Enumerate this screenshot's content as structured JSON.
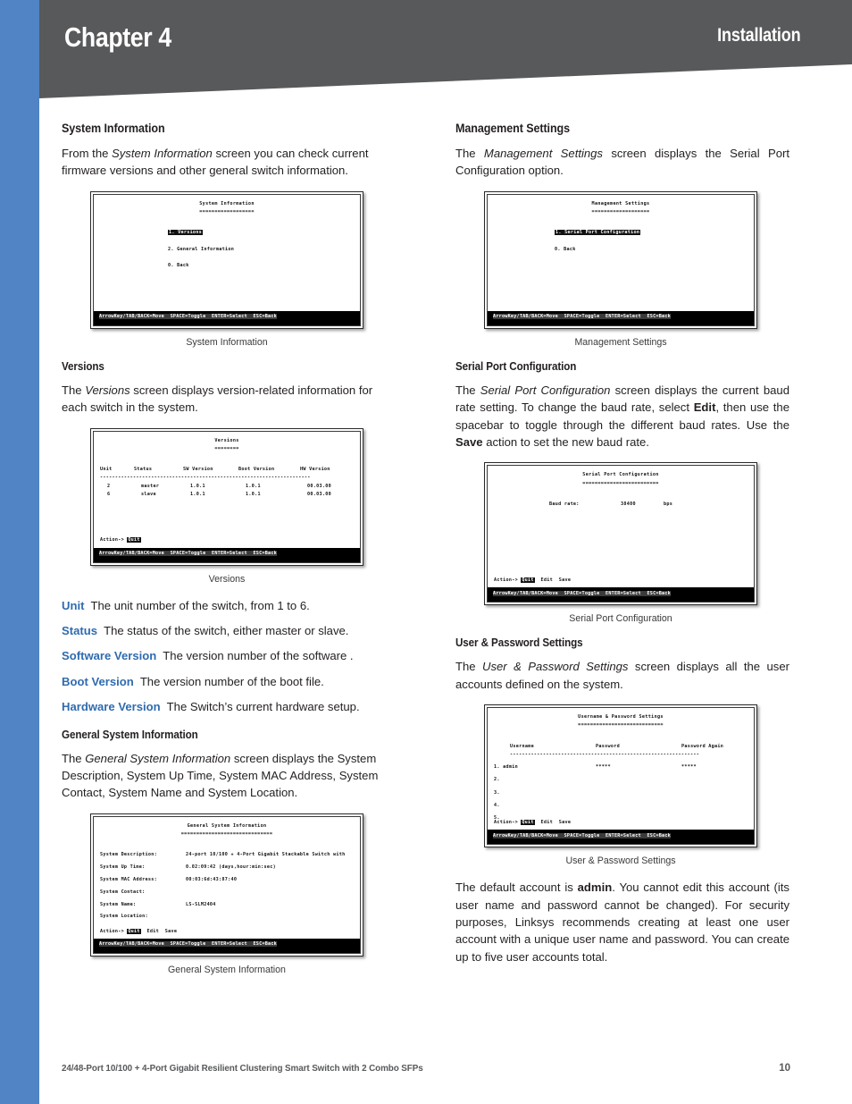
{
  "header": {
    "chapter": "Chapter 4",
    "section": "Installation",
    "band_color": "#58595b",
    "stripe_color": "#5084c4"
  },
  "footer": {
    "product": "24/48-Port 10/100 + 4-Port Gigabit Resilient Clustering Smart Switch with 2 Combo SFPs",
    "page": "10"
  },
  "left_column": {
    "system_information": {
      "heading": "System Information",
      "para_pre": "From the ",
      "para_em": "System Information",
      "para_post": " screen you can check current firmware versions and other general switch information.",
      "caption": "System Information",
      "terminal": {
        "title": "System Information",
        "rule": "==================",
        "items": [
          "1. Versions",
          "2. General Information",
          "0. Back"
        ],
        "highlighted_index": 0,
        "statusbar": "ArrowKey/TAB/BACK=Move  SPACE=Toggle  ENTER=Select  ESC=Back"
      }
    },
    "versions": {
      "heading": "Versions",
      "para_pre": "The ",
      "para_em": "Versions",
      "para_post": " screen displays version-related information for each switch in the system.",
      "caption": "Versions",
      "terminal": {
        "title": "Versions",
        "rule": "========",
        "columns": [
          "Unit",
          "Status",
          "SW Version",
          "Boot Version",
          "HW Version"
        ],
        "separator": "----------------------------------------------------------------------",
        "rows": [
          [
            "2",
            "master",
            "1.0.1",
            "1.0.1",
            "00.03.00"
          ],
          [
            "6",
            "slave",
            "1.0.1",
            "1.0.1",
            "00.03.00"
          ]
        ],
        "action_label": "Action->",
        "action_selected": "Quit",
        "statusbar": "ArrowKey/TAB/BACK=Move  SPACE=Toggle  ENTER=Select  ESC=Back"
      },
      "definitions": [
        {
          "term": "Unit",
          "desc": "The unit number of the switch, from 1 to 6."
        },
        {
          "term": "Status",
          "desc": "The status of the switch, either master or slave."
        },
        {
          "term": "Software Version",
          "desc": "The version number of the software ."
        },
        {
          "term": "Boot Version",
          "desc": "The version number of the boot file."
        },
        {
          "term": "Hardware Version",
          "desc": "The Switch’s current hardware setup."
        }
      ]
    },
    "general_system_information": {
      "heading": "General System Information",
      "para_pre": "The ",
      "para_em": "General System Information",
      "para_post": " screen displays the System Description, System Up Time, System MAC Address, System Contact, System Name and System Location.",
      "caption": "General System Information",
      "terminal": {
        "title": "General System Information",
        "rule": "==============================",
        "fields": [
          {
            "label": "System Description:",
            "value": "24-port 10/100 + 4-Port Gigabit Stackable Switch with"
          },
          {
            "label": "System Up Time:",
            "value": "0.02:09:42 (days,hour:min:sec)"
          },
          {
            "label": "System MAC Address:",
            "value": "00:03:6d:43:87:40"
          },
          {
            "label": "System Contact:",
            "value": ""
          },
          {
            "label": "System Name:",
            "value": "LS-SLM2404"
          },
          {
            "label": "System Location:",
            "value": ""
          }
        ],
        "action_label": "Action->",
        "action_selected": "Quit",
        "action_items": [
          "Edit",
          "Save"
        ],
        "statusbar": "ArrowKey/TAB/BACK=Move  SPACE=Toggle  ENTER=Select  ESC=Back"
      }
    }
  },
  "right_column": {
    "management_settings": {
      "heading": "Management Settings",
      "para_pre": "The ",
      "para_em": "Management Settings",
      "para_post": " screen displays the Serial Port Configuration option.",
      "caption": "Management Settings",
      "terminal": {
        "title": "Management Settings",
        "rule": "===================",
        "items": [
          "1. Serial Port Configuration",
          "0. Back"
        ],
        "highlighted_index": 0,
        "statusbar": "ArrowKey/TAB/BACK=Move  SPACE=Toggle  ENTER=Select  ESC=Back"
      }
    },
    "serial_port_configuration": {
      "heading": "Serial Port Configuration",
      "para_parts": {
        "p1": "The ",
        "em1": "Serial Port Configuration",
        "p2": " screen displays the current baud rate setting. To change the baud rate, select ",
        "b1": "Edit",
        "p3": ", then use the spacebar to toggle through the different baud rates. Use the ",
        "b2": "Save",
        "p4": " action to set the new baud rate."
      },
      "caption": "Serial Port Configuration",
      "terminal": {
        "title": "Serial Port Configuration",
        "rule": "=========================",
        "field_label": "Baud rate:",
        "field_value": "38400",
        "field_unit": "bps",
        "action_label": "Action->",
        "action_selected": "Quit",
        "action_items": [
          "Edit",
          "Save"
        ],
        "statusbar": "ArrowKey/TAB/BACK=Move  SPACE=Toggle  ENTER=Select  ESC=Back"
      }
    },
    "user_password_settings": {
      "heading": "User & Password Settings",
      "para_pre": "The ",
      "para_em": "User & Password Settings",
      "para_post": " screen displays all the user accounts defined on the system.",
      "caption": "User & Password Settings",
      "terminal": {
        "title": "Username & Password Settings",
        "rule": "============================",
        "columns": [
          "Username",
          "Password",
          "Password Again"
        ],
        "separator": "---------------------------------------------------------------",
        "rows": [
          [
            "1. admin",
            "*****",
            "*****"
          ],
          [
            "2.",
            "",
            ""
          ],
          [
            "3.",
            "",
            ""
          ],
          [
            "4.",
            "",
            ""
          ],
          [
            "5.",
            "",
            ""
          ]
        ],
        "action_label": "Action->",
        "action_selected": "Quit",
        "action_items": [
          "Edit",
          "Save"
        ],
        "statusbar": "ArrowKey/TAB/BACK=Move  SPACE=Toggle  ENTER=Select  ESC=Back"
      },
      "closing_parts": {
        "p1": "The default account is ",
        "b1": "admin",
        "p2": ". You cannot edit this account (its user name and password cannot be changed). For security purposes, Linksys recommends creating at least one user account with a unique user name and password. You can create up to five user accounts total."
      }
    }
  }
}
